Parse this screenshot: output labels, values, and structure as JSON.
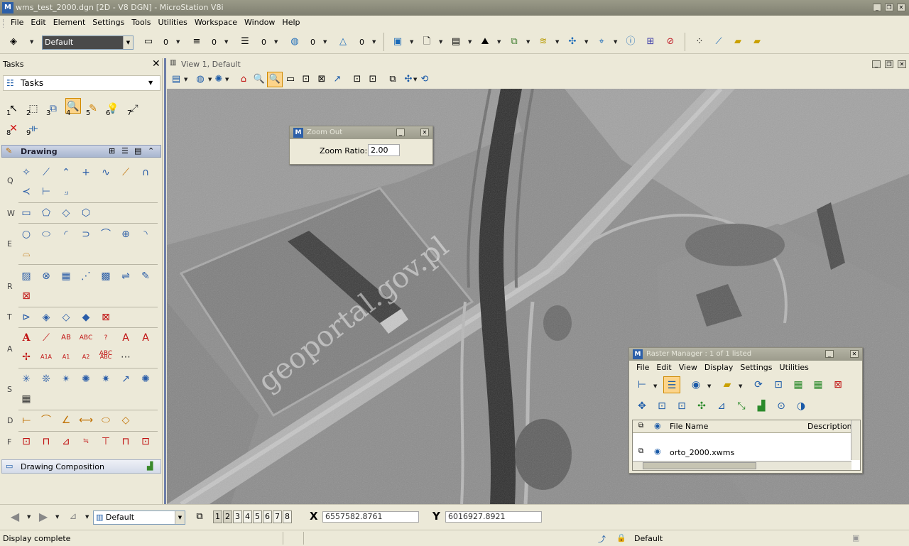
{
  "window": {
    "title": "wms_test_2000.dgn [2D - V8 DGN] - MicroStation V8i",
    "app_icon": "microstation-icon"
  },
  "menu": [
    "File",
    "Edit",
    "Element",
    "Settings",
    "Tools",
    "Utilities",
    "Workspace",
    "Window",
    "Help"
  ],
  "attributes": {
    "level": "Default",
    "color": "0",
    "style": "0",
    "weight": "0",
    "transparency": "0",
    "priority": "0"
  },
  "tasks": {
    "title": "Tasks",
    "selector": "Tasks",
    "main_numbers": [
      "1",
      "2",
      "3",
      "4",
      "5",
      "6",
      "7",
      "8",
      "9"
    ],
    "drawing_title": "Drawing",
    "row_labels": [
      "Q",
      "W",
      "E",
      "R",
      "T",
      "A",
      "S",
      "D",
      "F"
    ],
    "composition": "Drawing Composition"
  },
  "view": {
    "title": "View 1, Default",
    "watermark": "geoportal.gov.pl"
  },
  "zoom_dialog": {
    "title": "Zoom Out",
    "ratio_label": "Zoom Ratio:",
    "ratio_value": "2.00"
  },
  "raster_manager": {
    "title": "Raster Manager : 1 of 1 listed",
    "menu": [
      "File",
      "Edit",
      "View",
      "Display",
      "Settings",
      "Utilities"
    ],
    "col_file": "File Name",
    "col_desc": "Description",
    "file": "orto_2000.xwms"
  },
  "status": {
    "view_numbers": [
      "1",
      "2",
      "3",
      "4",
      "5",
      "6",
      "7",
      "8"
    ],
    "level": "Default",
    "x_label": "X",
    "x_value": "6557582.8761",
    "y_label": "Y",
    "y_value": "6016927.8921",
    "message": "Display complete",
    "active_level": "Default"
  }
}
